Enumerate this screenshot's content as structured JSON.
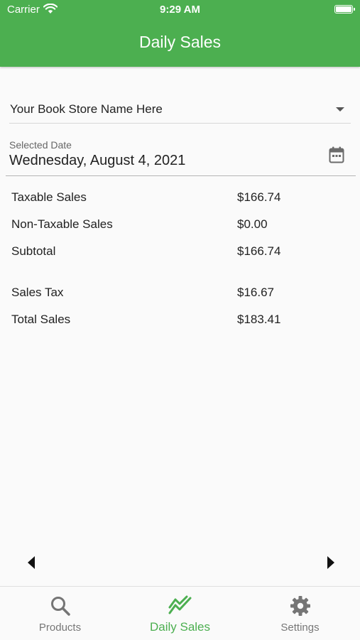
{
  "status_bar": {
    "carrier": "Carrier",
    "time": "9:29 AM"
  },
  "header": {
    "title": "Daily Sales"
  },
  "store_select": {
    "value": "Your Book Store Name Here"
  },
  "date_field": {
    "label": "Selected Date",
    "value": "Wednesday, August 4, 2021"
  },
  "summary": [
    {
      "label": "Taxable Sales",
      "value": "$166.74"
    },
    {
      "label": "Non-Taxable Sales",
      "value": "$0.00"
    },
    {
      "label": "Subtotal",
      "value": "$166.74"
    },
    {
      "label": "Sales Tax",
      "value": "$16.67"
    },
    {
      "label": "Total Sales",
      "value": "$183.41"
    }
  ],
  "tabs": [
    {
      "label": "Products",
      "icon": "search-icon",
      "active": false
    },
    {
      "label": "Daily Sales",
      "icon": "trending-icon",
      "active": true
    },
    {
      "label": "Settings",
      "icon": "gear-icon",
      "active": false
    }
  ],
  "colors": {
    "primary": "#4caf50",
    "inactive": "#777777",
    "background": "#fafafa"
  }
}
